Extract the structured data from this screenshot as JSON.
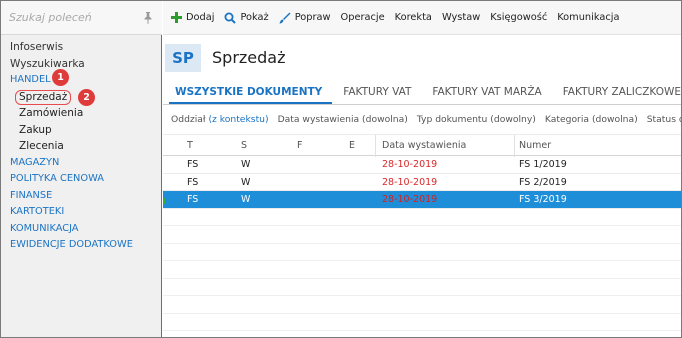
{
  "search": {
    "placeholder": "Szukaj poleceń"
  },
  "nav": {
    "infoserwis": "Infoserwis",
    "wyszukiwarka": "Wyszukiwarka",
    "handel": "HANDEL",
    "sprzedaz": "Sprzedaż",
    "zamowienia": "Zamówienia",
    "zakup": "Zakup",
    "zlecenia": "Zlecenia",
    "magazyn": "MAGAZYN",
    "polityka": "POLITYKA CENOWA",
    "finanse": "FINANSE",
    "kartoteki": "KARTOTEKI",
    "komunikacja": "KOMUNIKACJA",
    "ewidencje": "EWIDENCJE DODATKOWE"
  },
  "badges": {
    "one": "1",
    "two": "2"
  },
  "toolbar": {
    "dodaj": "Dodaj",
    "pokaz": "Pokaż",
    "popraw": "Popraw",
    "operacje": "Operacje",
    "korekta": "Korekta",
    "wystaw": "Wystaw",
    "ksiegowosc": "Księgowość",
    "komunikacja": "Komunikacja"
  },
  "header": {
    "code": "SP",
    "title": "Sprzedaż"
  },
  "tabs": [
    {
      "label": "WSZYSTKIE DOKUMENTY",
      "active": true
    },
    {
      "label": "FAKTURY VAT",
      "active": false
    },
    {
      "label": "FAKTURY VAT MARŻA",
      "active": false
    },
    {
      "label": "FAKTURY ZALICZKOWE",
      "active": false
    }
  ],
  "filters": {
    "oddzial_prefix": "Oddział",
    "oddzial_ctx": "(z kontekstu)",
    "data": "Data wystawienia (dowolna)",
    "typ": "Typ dokumentu (dowolny)",
    "kategoria": "Kategoria (dowolna)",
    "status": "Status dokumentu"
  },
  "table": {
    "headers": {
      "t": "T",
      "s": "S",
      "f": "F",
      "e": "E",
      "date": "Data wystawienia",
      "numer": "Numer"
    },
    "rows": [
      {
        "t": "FS",
        "s": "W",
        "date": "28-10-2019",
        "numer": "FS 1/2019"
      },
      {
        "t": "FS",
        "s": "W",
        "date": "28-10-2019",
        "numer": "FS 2/2019"
      },
      {
        "t": "FS",
        "s": "W",
        "date": "28-10-2019",
        "numer": "FS 3/2019"
      }
    ]
  },
  "colors": {
    "accent": "#1b73c4",
    "selected_row": "#1f8ed8",
    "badge": "#e03b3b",
    "date": "#d9282a"
  }
}
